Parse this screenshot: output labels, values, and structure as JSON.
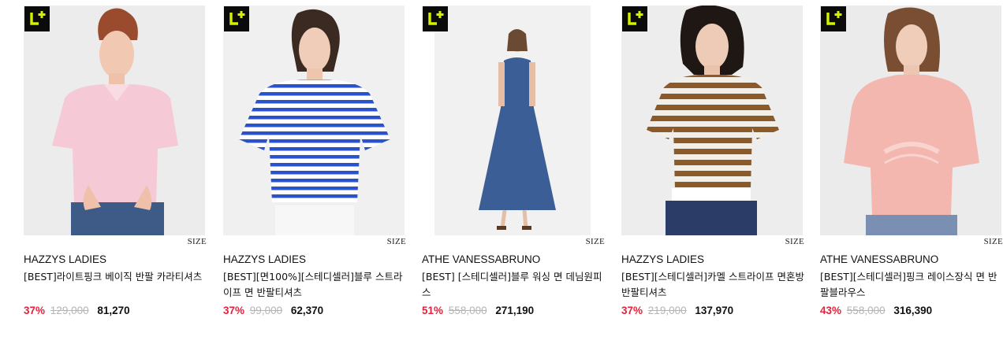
{
  "colors": {
    "badge_bg": "#0b0b0b",
    "badge_accent": "#d4f200",
    "discount": "#e3213b",
    "original_price": "#b5b5b5"
  },
  "products": [
    {
      "brand": "HAZZYS LADIES",
      "name": "[BEST]라이트핑크 베이직 반팔 카라티셔츠",
      "discount": "37%",
      "original_price": "129,000",
      "sale_price": "81,270",
      "size_label": "SIZE",
      "badge_icon": "l-plus-icon"
    },
    {
      "brand": "HAZZYS LADIES",
      "name": "[BEST][면100%][스테디셀러]블루 스트라이프 면 반팔티셔츠",
      "discount": "37%",
      "original_price": "99,000",
      "sale_price": "62,370",
      "size_label": "SIZE",
      "badge_icon": "l-plus-icon"
    },
    {
      "brand": "ATHE VANESSABRUNO",
      "name": "[BEST] [스테디셀러]블루 워싱 면 데님원피스",
      "discount": "51%",
      "original_price": "558,000",
      "sale_price": "271,190",
      "size_label": "SIZE",
      "badge_icon": "l-plus-icon"
    },
    {
      "brand": "HAZZYS LADIES",
      "name": "[BEST][스테디셀러]카멜 스트라이프 면혼방 반팔티셔츠",
      "discount": "37%",
      "original_price": "219,000",
      "sale_price": "137,970",
      "size_label": "SIZE",
      "badge_icon": "l-plus-icon"
    },
    {
      "brand": "ATHE VANESSABRUNO",
      "name": "[BEST][스테디셀러]핑크 레이스장식 면 반팔블라우스",
      "discount": "43%",
      "original_price": "558,000",
      "sale_price": "316,390",
      "size_label": "SIZE",
      "badge_icon": "l-plus-icon"
    }
  ]
}
